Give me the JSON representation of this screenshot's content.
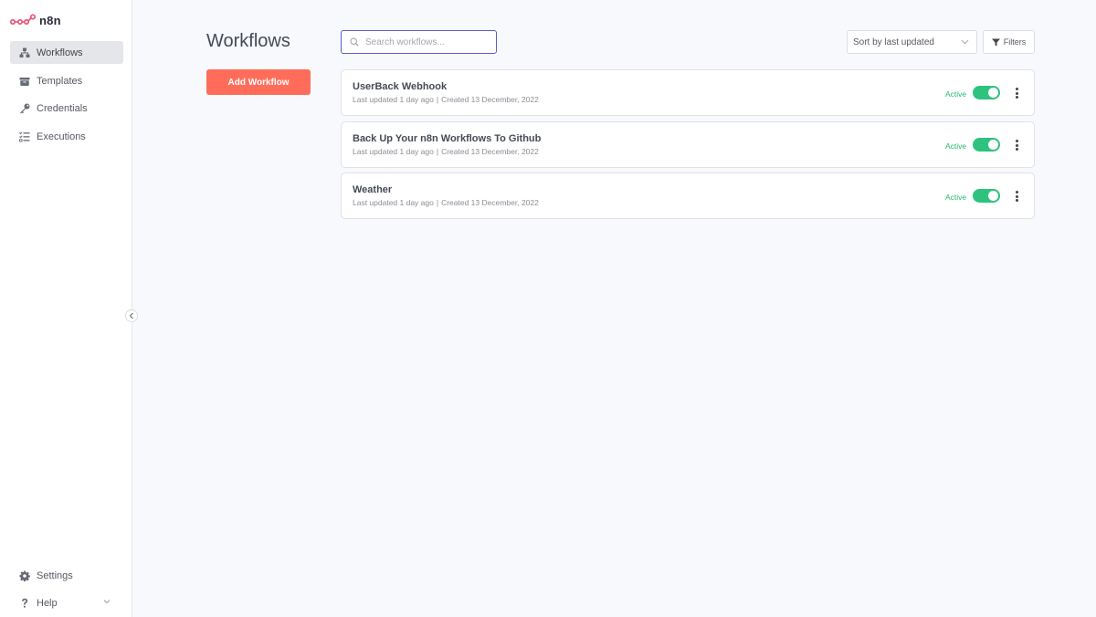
{
  "app": {
    "logo_text": "n8n",
    "accent": "#ff6d5a",
    "selection": "#5b5fc7"
  },
  "sidebar": {
    "items": [
      {
        "label": "Workflows",
        "icon": "network-icon",
        "active": true
      },
      {
        "label": "Templates",
        "icon": "box-icon",
        "active": false
      },
      {
        "label": "Credentials",
        "icon": "key-icon",
        "active": false
      },
      {
        "label": "Executions",
        "icon": "tasks-list-icon",
        "active": false
      }
    ],
    "bottom": [
      {
        "label": "Settings",
        "icon": "gear-icon"
      },
      {
        "label": "Help",
        "icon": "question-icon"
      }
    ]
  },
  "main": {
    "title": "Workflows",
    "add_button": "Add Workflow",
    "search": {
      "placeholder": "Search workflows...",
      "value": ""
    },
    "sort": {
      "selected": "Sort by last updated"
    },
    "filters_label": "Filters"
  },
  "workflows": [
    {
      "name": "UserBack Webhook",
      "updated": "Last updated 1 day ago",
      "created": "Created 13 December, 2022",
      "status": "Active",
      "active": true
    },
    {
      "name": "Back Up Your n8n Workflows To Github",
      "updated": "Last updated 1 day ago",
      "created": "Created 13 December, 2022",
      "status": "Active",
      "active": true
    },
    {
      "name": "Weather",
      "updated": "Last updated 1 day ago",
      "created": "Created 13 December, 2022",
      "status": "Active",
      "active": true
    }
  ],
  "colors": {
    "active_green": "#24b96b",
    "toggle_green": "#2ec27e"
  }
}
